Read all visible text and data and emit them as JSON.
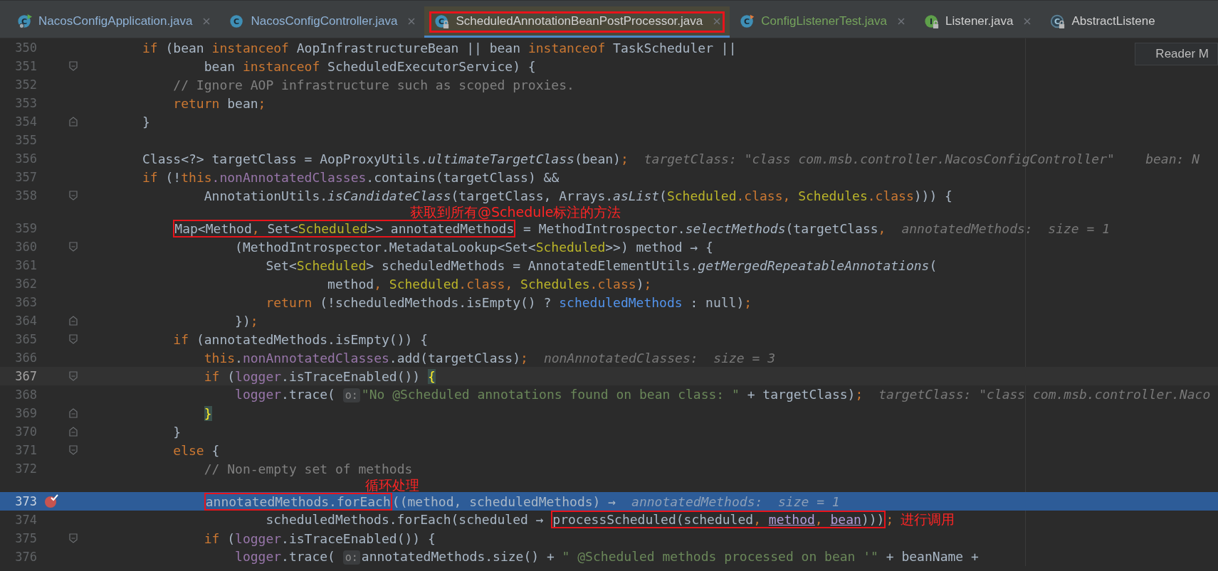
{
  "tabs": [
    {
      "label": "NacosConfigApplication.java",
      "selected": false,
      "closable": true,
      "color": "#8fb2d6",
      "icon": {
        "kind": "application",
        "letter": "C",
        "locked": false
      }
    },
    {
      "label": "NacosConfigController.java",
      "selected": false,
      "closable": true,
      "color": "#8fb2d6",
      "icon": {
        "kind": "class",
        "letter": "C",
        "locked": false
      }
    },
    {
      "label": "ScheduledAnnotationBeanPostProcessor.java",
      "selected": true,
      "closable": true,
      "color": "#d2d2d2",
      "icon": {
        "kind": "class",
        "letter": "C",
        "locked": true
      },
      "boxed": true
    },
    {
      "label": "ConfigListenerTest.java",
      "selected": false,
      "closable": true,
      "color": "#75a35c",
      "icon": {
        "kind": "test",
        "letter": "C",
        "locked": false
      }
    },
    {
      "label": "Listener.java",
      "selected": false,
      "closable": true,
      "color": "#cfcfcf",
      "icon": {
        "kind": "interface",
        "letter": "I",
        "locked": true
      }
    },
    {
      "label": "AbstractListene",
      "selected": false,
      "closable": false,
      "color": "#cfcfcf",
      "icon": {
        "kind": "abstract",
        "letter": "C",
        "locked": true
      }
    }
  ],
  "reader_mode": "Reader M",
  "lines": [
    {
      "number": "350",
      "current": false,
      "caret": false,
      "breakpoint": false,
      "tokens": [
        {
          "text": "if",
          "kind": "keyword"
        },
        {
          "text": " (bean ",
          "kind": "plain"
        },
        {
          "text": "instanceof",
          "kind": "keyword"
        },
        {
          "text": " AopInfrastructureBean || bean ",
          "kind": "plain"
        },
        {
          "text": "instanceof",
          "kind": "keyword"
        },
        {
          "text": " TaskScheduler ||",
          "kind": "plain"
        }
      ]
    },
    {
      "number": "351",
      "current": false,
      "caret": false,
      "breakpoint": false,
      "fold": {
        "kind": "start"
      },
      "tokens": [
        {
          "text": "        bean ",
          "kind": "plain"
        },
        {
          "text": "instanceof",
          "kind": "keyword"
        },
        {
          "text": " ScheduledExecutorService) {",
          "kind": "plain"
        }
      ]
    },
    {
      "number": "352",
      "current": false,
      "caret": false,
      "breakpoint": false,
      "tokens": [
        {
          "text": "    // Ignore AOP infrastructure such as scoped proxies.",
          "kind": "comment"
        }
      ]
    },
    {
      "number": "353",
      "current": false,
      "caret": false,
      "breakpoint": false,
      "tokens": [
        {
          "text": "    return",
          "kind": "keyword"
        },
        {
          "text": " bean",
          "kind": "plain"
        },
        {
          "text": ";",
          "kind": "keyword"
        }
      ]
    },
    {
      "number": "354",
      "current": false,
      "caret": false,
      "breakpoint": false,
      "fold": {
        "kind": "end"
      },
      "tokens": [
        {
          "text": "}",
          "kind": "plain"
        }
      ]
    },
    {
      "number": "355",
      "current": false,
      "caret": false,
      "breakpoint": false
    },
    {
      "number": "356",
      "current": false,
      "caret": false,
      "breakpoint": false,
      "tokens": [
        {
          "text": "Class<?> targetClass = AopProxyUtils.",
          "kind": "plain"
        },
        {
          "text": "ultimateTargetClass",
          "kind": "italic"
        },
        {
          "text": "(bean)",
          "kind": "plain"
        },
        {
          "text": ";",
          "kind": "keyword"
        },
        {
          "text": "targetClass: \"class com.msb.controller.NacosConfigController\"    bean: N",
          "kind": "debug"
        }
      ]
    },
    {
      "number": "357",
      "current": false,
      "caret": false,
      "breakpoint": false,
      "tokens": [
        {
          "text": "if",
          "kind": "keyword"
        },
        {
          "text": " (!",
          "kind": "plain"
        },
        {
          "text": "this",
          "kind": "keyword"
        },
        {
          "text": ".nonAnnotatedClasses",
          "kind": "field"
        },
        {
          "text": ".contains(targetClass) &&",
          "kind": "plain"
        }
      ]
    },
    {
      "number": "358",
      "current": false,
      "caret": false,
      "breakpoint": false,
      "fold": {
        "kind": "start"
      },
      "tokens": [
        {
          "text": "        AnnotationUtils.",
          "kind": "plain"
        },
        {
          "text": "isCandidateClass",
          "kind": "italic"
        },
        {
          "text": "(targetClass, Arrays.",
          "kind": "plain"
        },
        {
          "text": "asList",
          "kind": "italic"
        },
        {
          "text": "(",
          "kind": "plain"
        },
        {
          "text": "Scheduled",
          "kind": "annotation"
        },
        {
          "text": ".class, ",
          "kind": "keyword"
        },
        {
          "text": "Schedules",
          "kind": "annotation"
        },
        {
          "text": ".class",
          "kind": "keyword"
        },
        {
          "text": "))) {",
          "kind": "plain"
        }
      ]
    },
    {
      "number": "359",
      "current": false,
      "caret": false,
      "breakpoint": false,
      "tokens": [
        {
          "kind": "box",
          "note": "获取到所有@Schedule标注的方法",
          "tokens": [
            {
              "text": "    Map<Method",
              "kind": "plain"
            },
            {
              "text": ",",
              "kind": "keyword"
            },
            {
              "text": " Set<",
              "kind": "plain"
            },
            {
              "text": "Scheduled",
              "kind": "annotation"
            },
            {
              "text": ">> annotatedMethods",
              "kind": "plain"
            }
          ]
        },
        {
          "text": " = MethodIntrospector.",
          "kind": "plain"
        },
        {
          "text": "selectMethods",
          "kind": "italic"
        },
        {
          "text": "(targetClass",
          "kind": "plain"
        },
        {
          "text": ",",
          "kind": "keyword"
        },
        {
          "text": "annotatedMethods:  size = 1",
          "kind": "debug"
        }
      ]
    },
    {
      "number": "360",
      "current": false,
      "caret": false,
      "breakpoint": false,
      "fold": {
        "kind": "start"
      },
      "tokens": [
        {
          "text": "            (MethodIntrospector.MetadataLookup<Set<",
          "kind": "plain"
        },
        {
          "text": "Scheduled",
          "kind": "annotation"
        },
        {
          "text": ">>) method → {",
          "kind": "plain"
        }
      ]
    },
    {
      "number": "361",
      "current": false,
      "caret": false,
      "breakpoint": false,
      "tokens": [
        {
          "text": "                Set<",
          "kind": "plain"
        },
        {
          "text": "Scheduled",
          "kind": "annotation"
        },
        {
          "text": "> scheduledMethods = AnnotatedElementUtils.",
          "kind": "plain"
        },
        {
          "text": "getMergedRepeatableAnnotations",
          "kind": "italic"
        },
        {
          "text": "(",
          "kind": "plain"
        }
      ]
    },
    {
      "number": "362",
      "current": false,
      "caret": false,
      "breakpoint": false,
      "tokens": [
        {
          "text": "                        method",
          "kind": "plain"
        },
        {
          "text": ", ",
          "kind": "keyword"
        },
        {
          "text": "Scheduled",
          "kind": "annotation"
        },
        {
          "text": ".class, ",
          "kind": "keyword"
        },
        {
          "text": "Schedules",
          "kind": "annotation"
        },
        {
          "text": ".class",
          "kind": "keyword"
        },
        {
          "text": ")",
          "kind": "plain"
        },
        {
          "text": ";",
          "kind": "keyword"
        }
      ]
    },
    {
      "number": "363",
      "current": false,
      "caret": false,
      "breakpoint": false,
      "tokens": [
        {
          "text": "                return",
          "kind": "keyword"
        },
        {
          "text": " (!scheduledMethods.isEmpty() ? ",
          "kind": "plain"
        },
        {
          "text": "scheduledMethods",
          "kind": "local"
        },
        {
          "text": " : null)",
          "kind": "plain"
        },
        {
          "text": ";",
          "kind": "keyword"
        }
      ]
    },
    {
      "number": "364",
      "current": false,
      "caret": false,
      "breakpoint": false,
      "fold": {
        "kind": "end"
      },
      "tokens": [
        {
          "text": "            })",
          "kind": "plain"
        },
        {
          "text": ";",
          "kind": "keyword"
        }
      ]
    },
    {
      "number": "365",
      "current": false,
      "caret": false,
      "breakpoint": false,
      "fold": {
        "kind": "start"
      },
      "tokens": [
        {
          "text": "    if",
          "kind": "keyword"
        },
        {
          "text": " (annotatedMethods.isEmpty()) {",
          "kind": "plain"
        }
      ]
    },
    {
      "number": "366",
      "current": false,
      "caret": false,
      "breakpoint": false,
      "tokens": [
        {
          "text": "        this",
          "kind": "keyword"
        },
        {
          "text": ".",
          "kind": "plain"
        },
        {
          "text": "nonAnnotatedClasses",
          "kind": "field"
        },
        {
          "text": ".add(targetClass)",
          "kind": "plain"
        },
        {
          "text": ";",
          "kind": "keyword"
        },
        {
          "text": "nonAnnotatedClasses:  size = 3",
          "kind": "debug"
        }
      ]
    },
    {
      "number": "367",
      "current": false,
      "caret": true,
      "breakpoint": false,
      "fold": {
        "kind": "start"
      },
      "tokens": [
        {
          "text": "        if",
          "kind": "keyword"
        },
        {
          "text": " (",
          "kind": "plain"
        },
        {
          "text": "logger",
          "kind": "field"
        },
        {
          "text": ".isTraceEnabled()) ",
          "kind": "plain"
        },
        {
          "text": "{",
          "kind": "brace"
        }
      ]
    },
    {
      "number": "368",
      "current": false,
      "caret": false,
      "breakpoint": false,
      "tokens": [
        {
          "text": "            logger",
          "kind": "field"
        },
        {
          "text": ".trace( ",
          "kind": "plain"
        },
        {
          "text": "o:",
          "kind": "hint"
        },
        {
          "text": "\"No @Scheduled annotations found on bean class: \"",
          "kind": "string"
        },
        {
          "text": " + targetClass)",
          "kind": "plain"
        },
        {
          "text": ";",
          "kind": "keyword"
        },
        {
          "text": "targetClass: \"class com.msb.controller.Naco",
          "kind": "debug"
        }
      ]
    },
    {
      "number": "369",
      "current": false,
      "caret": false,
      "breakpoint": false,
      "fold": {
        "kind": "end"
      },
      "tokens": [
        {
          "text": "        }",
          "kind": "brace"
        }
      ]
    },
    {
      "number": "370",
      "current": false,
      "caret": false,
      "breakpoint": false,
      "fold": {
        "kind": "end"
      },
      "tokens": [
        {
          "text": "    }",
          "kind": "plain"
        }
      ]
    },
    {
      "number": "371",
      "current": false,
      "caret": false,
      "breakpoint": false,
      "fold": {
        "kind": "start"
      },
      "tokens": [
        {
          "text": "    else",
          "kind": "keyword"
        },
        {
          "text": " {",
          "kind": "plain"
        }
      ]
    },
    {
      "number": "372",
      "current": false,
      "caret": false,
      "breakpoint": false,
      "tokens": [
        {
          "text": "        // Non-empty set of methods",
          "kind": "comment"
        }
      ]
    },
    {
      "number": "373",
      "current": true,
      "caret": false,
      "breakpoint": true,
      "tokens": [
        {
          "kind": "box",
          "note": "循环处理",
          "tokens": [
            {
              "text": "        annotatedMethods.forEach",
              "kind": "plain"
            }
          ]
        },
        {
          "text": "((method, scheduledMethods) →",
          "kind": "plain"
        },
        {
          "text": "annotatedMethods:  size = 1",
          "kind": "debug"
        }
      ]
    },
    {
      "number": "374",
      "current": false,
      "caret": false,
      "breakpoint": false,
      "tokens": [
        {
          "text": "                scheduledMethods.forEach(scheduled → ",
          "kind": "plain"
        },
        {
          "kind": "box",
          "tokens": [
            {
              "text": "processScheduled(scheduled",
              "kind": "plain"
            },
            {
              "text": ", ",
              "kind": "keyword"
            },
            {
              "text": "method",
              "kind": "param"
            },
            {
              "text": ", ",
              "kind": "keyword"
            },
            {
              "text": "bean",
              "kind": "param"
            },
            {
              "text": ")))",
              "kind": "plain"
            }
          ]
        },
        {
          "text": ";",
          "kind": "keyword"
        },
        {
          "text": "进行调用",
          "kind": "note"
        }
      ]
    },
    {
      "number": "375",
      "current": false,
      "caret": false,
      "breakpoint": false,
      "fold": {
        "kind": "start"
      },
      "tokens": [
        {
          "text": "        if",
          "kind": "keyword"
        },
        {
          "text": " (",
          "kind": "plain"
        },
        {
          "text": "logger",
          "kind": "field"
        },
        {
          "text": ".isTraceEnabled()) {",
          "kind": "plain"
        }
      ]
    },
    {
      "number": "376",
      "current": false,
      "caret": false,
      "breakpoint": false,
      "tokens": [
        {
          "text": "            logger",
          "kind": "field"
        },
        {
          "text": ".trace( ",
          "kind": "plain"
        },
        {
          "text": "o:",
          "kind": "hint"
        },
        {
          "text": "annotatedMethods.size() + ",
          "kind": "plain"
        },
        {
          "text": "\" @Scheduled methods processed on bean '\"",
          "kind": "string"
        },
        {
          "text": " + beanName +",
          "kind": "plain"
        }
      ]
    }
  ]
}
